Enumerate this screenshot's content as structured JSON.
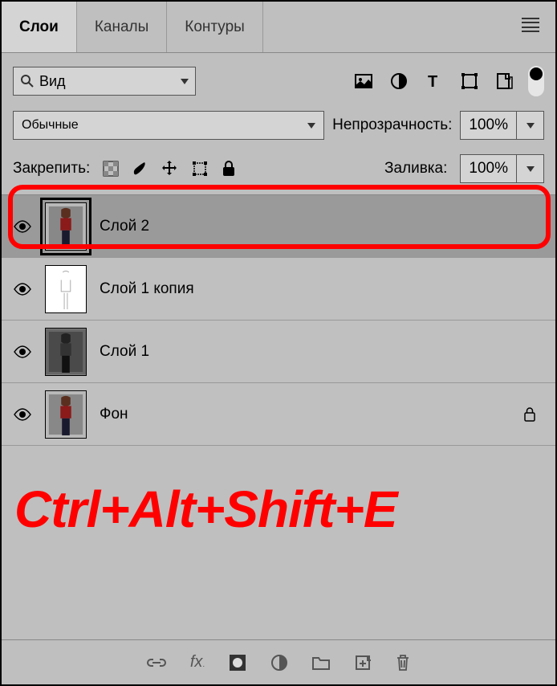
{
  "tabs": {
    "layers": "Слои",
    "channels": "Каналы",
    "paths": "Контуры"
  },
  "search": {
    "label": "Вид"
  },
  "blend": {
    "mode": "Обычные"
  },
  "opacity": {
    "label": "Непрозрачность:",
    "value": "100%"
  },
  "lock": {
    "label": "Закрепить:"
  },
  "fill": {
    "label": "Заливка:",
    "value": "100%"
  },
  "layers_list": [
    {
      "name": "Слой 2",
      "selected": true,
      "locked": false,
      "thumb": "photo"
    },
    {
      "name": "Слой 1 копия",
      "selected": false,
      "locked": false,
      "thumb": "sketch"
    },
    {
      "name": "Слой 1",
      "selected": false,
      "locked": false,
      "thumb": "photo-gray"
    },
    {
      "name": "Фон",
      "selected": false,
      "locked": true,
      "thumb": "photo"
    }
  ],
  "shortcut": "Ctrl+Alt+Shift+E"
}
